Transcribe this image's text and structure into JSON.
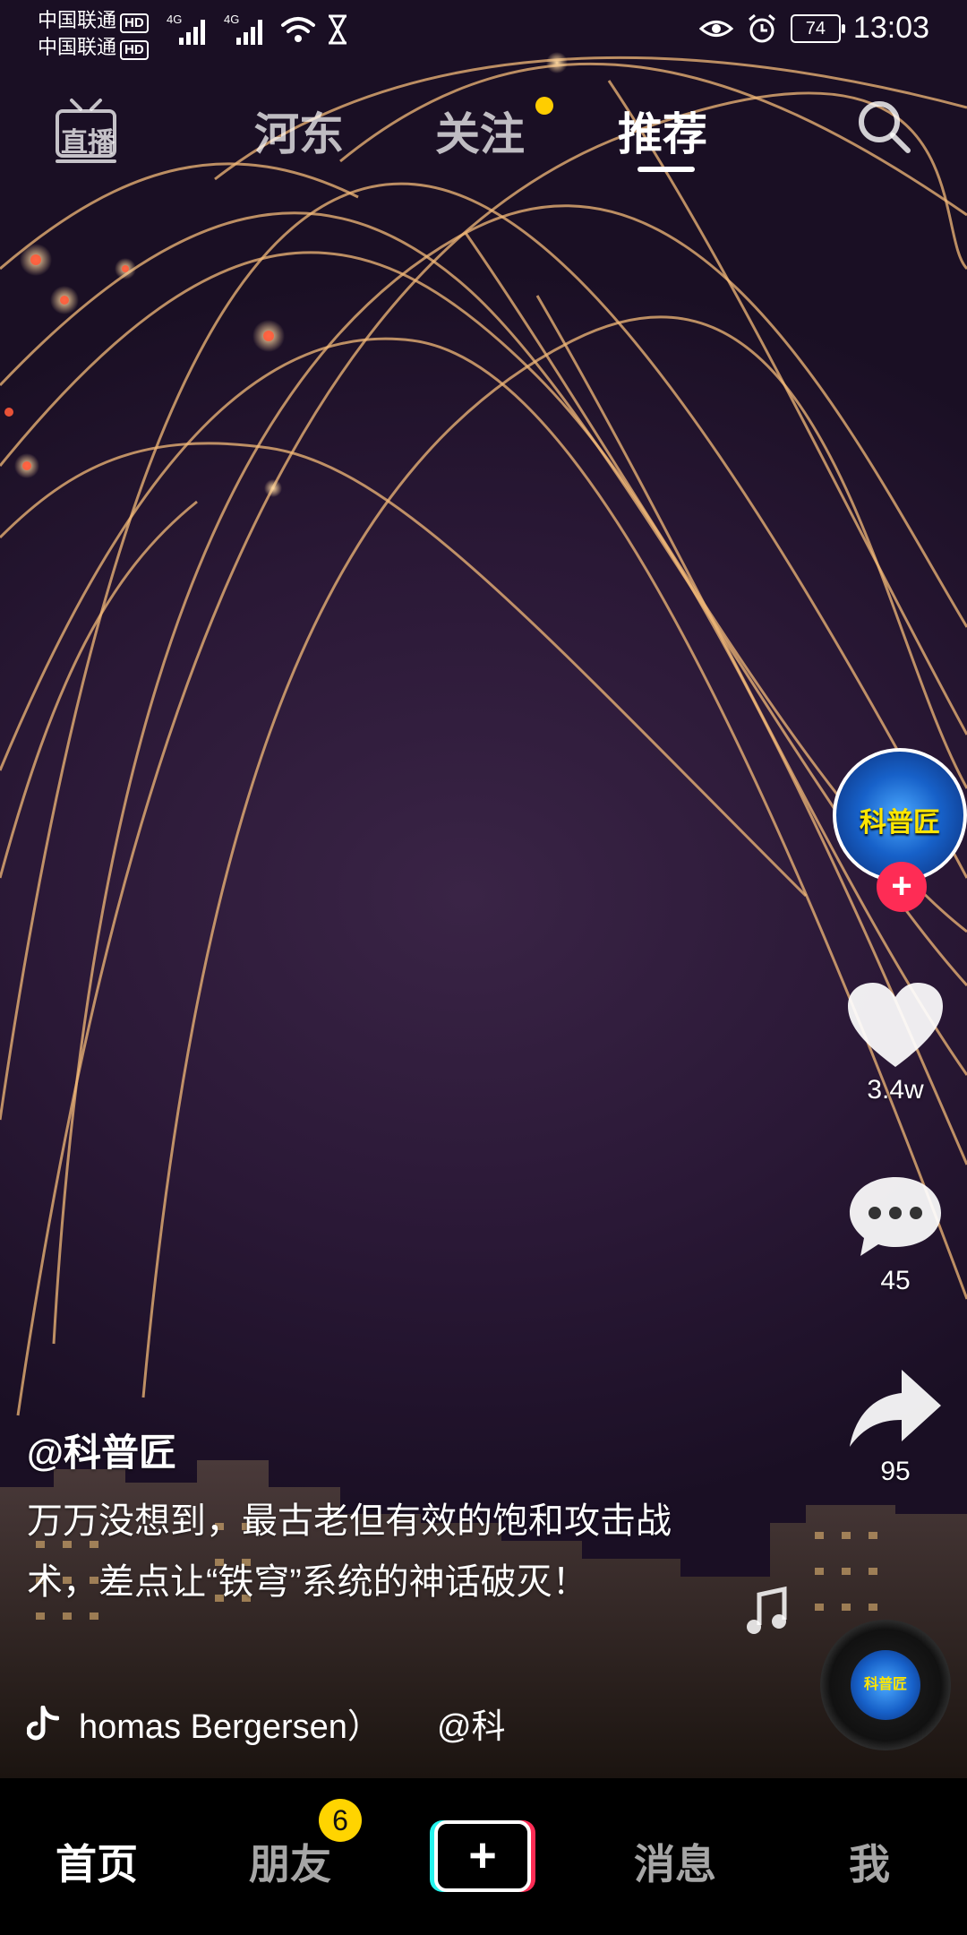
{
  "status_bar": {
    "carrier_1": "中国联通",
    "carrier_2": "中国联通",
    "hd": "HD",
    "net_1": "4G",
    "net_2": "4G",
    "battery": "74",
    "time": "13:03"
  },
  "top_tabs": {
    "live": "直播",
    "items": [
      {
        "label": "河东"
      },
      {
        "label": "关注"
      },
      {
        "label": "推荐"
      }
    ],
    "active": "推荐"
  },
  "creator": {
    "avatar_text": "科普匠",
    "follow": "+"
  },
  "actions": {
    "likes": "3.4w",
    "comments": "45",
    "shares": "95"
  },
  "caption": {
    "author": "@科普匠",
    "description": "万万没想到，最古老但有效的饱和攻击战术，差点让“铁穹”系统的神话破灭！",
    "music": "homas Bergersen）",
    "mention": "@科"
  },
  "disc": {
    "label": "科普匠"
  },
  "bottom_nav": {
    "home": "首页",
    "friends": "朋友",
    "friends_badge": "6",
    "create": "+",
    "messages": "消息",
    "me": "我"
  },
  "colors": {
    "accent_red": "#fe2c55",
    "accent_cyan": "#25f4ee",
    "badge_yellow": "#ffd400"
  }
}
